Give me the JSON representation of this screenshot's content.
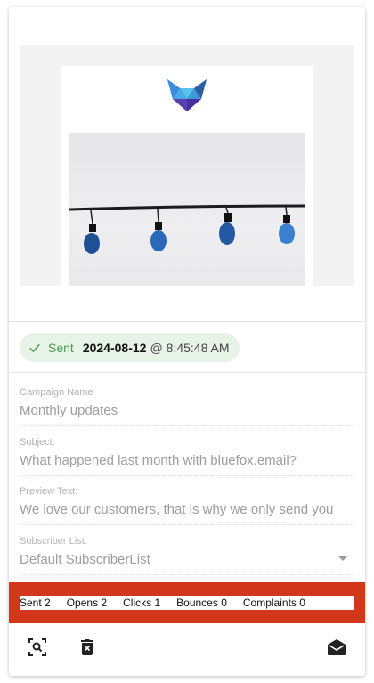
{
  "status": {
    "label": "Sent",
    "date": "2024-08-12",
    "at": "@",
    "time": "8:45:48 AM"
  },
  "fields": {
    "campaign_name": {
      "label": "Campaign Name",
      "value": "Monthly updates"
    },
    "subject": {
      "label": "Subject:",
      "value": "What happened last month with bluefox.email?"
    },
    "preview_text": {
      "label": "Preview Text:",
      "value": "We love our customers, that is why we only send you"
    },
    "subscriber_list": {
      "label": "Subscriber List:",
      "value": "Default SubscriberList"
    }
  },
  "stats": [
    {
      "label": "Sent",
      "value": "2"
    },
    {
      "label": "Opens",
      "value": "2"
    },
    {
      "label": "Clicks",
      "value": "1"
    },
    {
      "label": "Bounces",
      "value": "0"
    },
    {
      "label": "Complaints",
      "value": "0"
    }
  ],
  "icons": {
    "logo": "fox-logo",
    "hero": "light-bulbs-image",
    "status": "check-icon",
    "preview": "zoom-search-icon",
    "delete": "delete-icon",
    "open": "opened-mail-icon"
  },
  "colors": {
    "accent_red": "#d3371b",
    "sent_chip_bg": "#e8f3e8",
    "sent_green": "#4a9a52",
    "logo_blue": "#2f6fb5"
  }
}
